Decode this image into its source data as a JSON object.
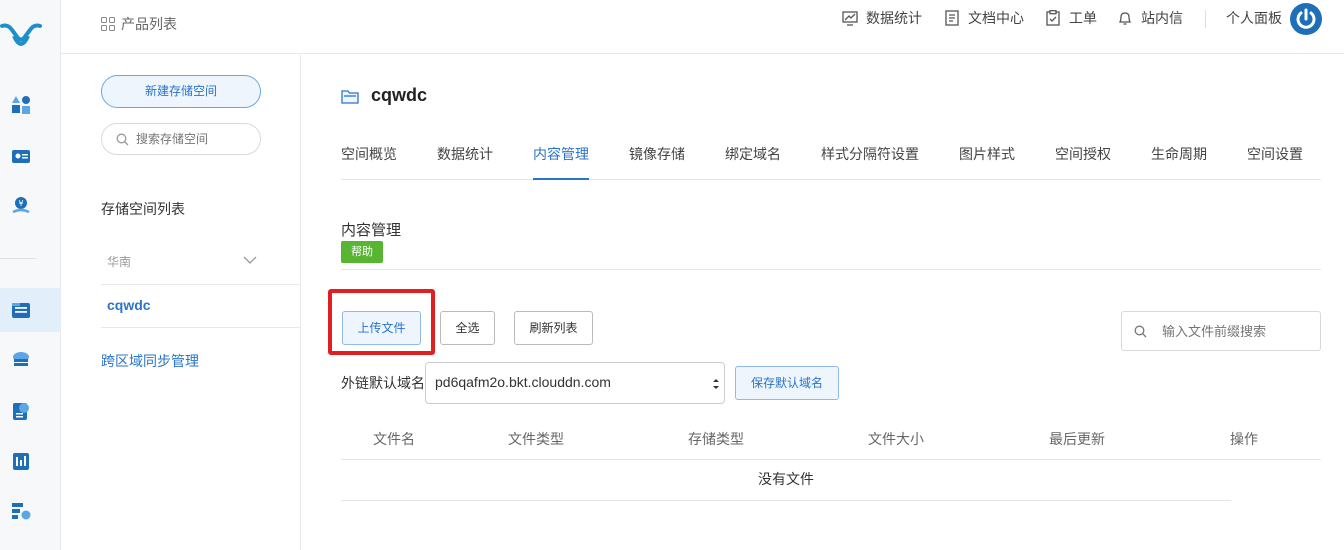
{
  "header": {
    "product_list": "产品列表",
    "nav": [
      {
        "label": "数据统计",
        "icon": "chart-icon"
      },
      {
        "label": "文档中心",
        "icon": "document-icon"
      },
      {
        "label": "工单",
        "icon": "clipboard-icon"
      },
      {
        "label": "站内信",
        "icon": "bell-icon"
      }
    ],
    "personal_panel": "个人面板"
  },
  "sidebar": {
    "new_bucket": "新建存储空间",
    "search_placeholder": "搜索存储空间",
    "list_title": "存储空间列表",
    "region": "华南",
    "bucket": "cqwdc",
    "cross_region": "跨区域同步管理"
  },
  "main": {
    "bucket_name": "cqwdc",
    "tabs": [
      "空间概览",
      "数据统计",
      "内容管理",
      "镜像存储",
      "绑定域名",
      "样式分隔符设置",
      "图片样式",
      "空间授权",
      "生命周期",
      "空间设置"
    ],
    "active_tab": "内容管理",
    "section_title": "内容管理",
    "help": "帮助",
    "upload": "上传文件",
    "select_all": "全选",
    "refresh": "刷新列表",
    "file_search_placeholder": "输入文件前缀搜索",
    "domain_label": "外链默认域名",
    "domain_value": "pd6qafm2o.bkt.clouddn.com",
    "save_domain": "保存默认域名",
    "columns": [
      "文件名",
      "文件类型",
      "存储类型",
      "文件大小",
      "最后更新",
      "操作"
    ],
    "empty": "没有文件"
  },
  "colors": {
    "accent": "#2a74c9",
    "help_green": "#58b531",
    "highlight_red": "#e02020"
  }
}
